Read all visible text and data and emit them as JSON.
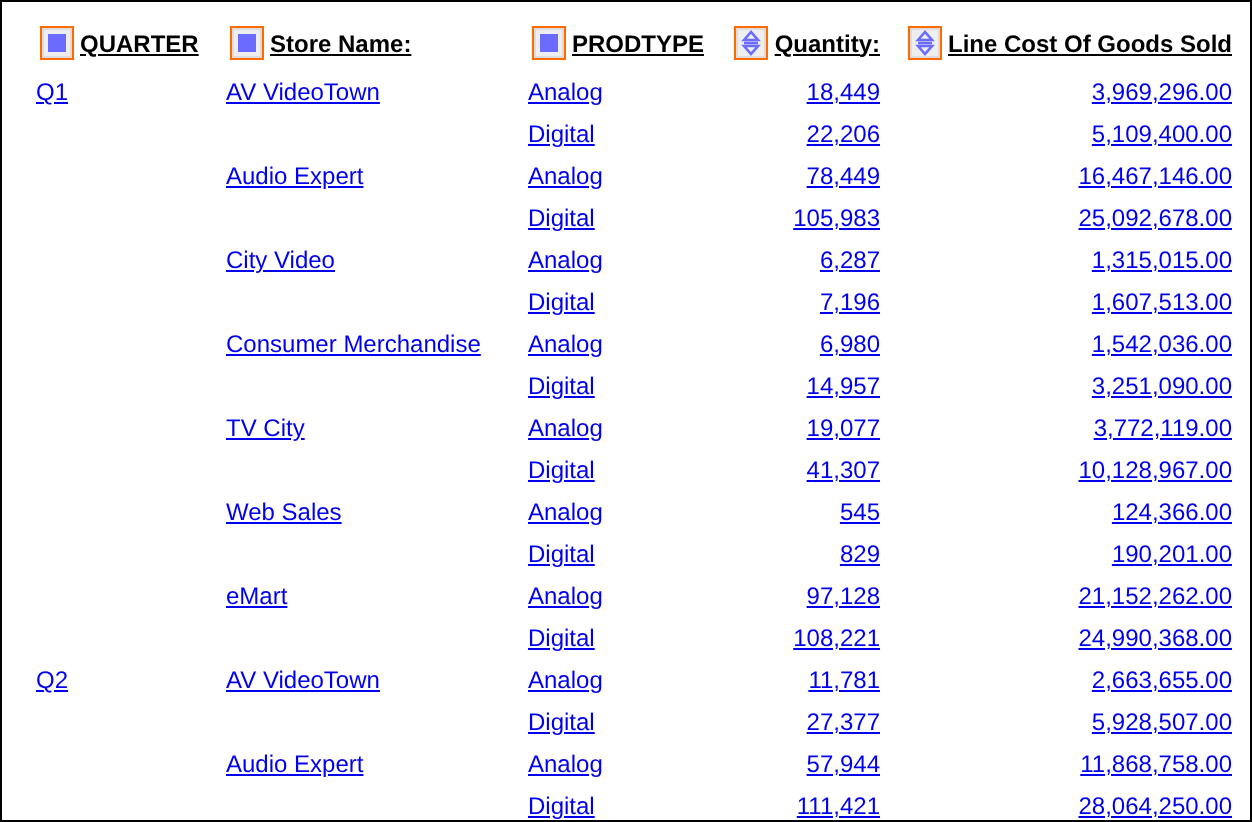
{
  "columns": [
    {
      "label": "QUARTER",
      "kind": "dimension"
    },
    {
      "label": "Store Name:",
      "kind": "dimension"
    },
    {
      "label": "PRODTYPE",
      "kind": "dimension"
    },
    {
      "label": "Quantity:",
      "kind": "measure"
    },
    {
      "label": "Line Cost Of Goods Sold",
      "kind": "measure"
    }
  ],
  "rows": [
    {
      "quarter": "Q1",
      "store": "AV VideoTown",
      "prodtype": "Analog",
      "quantity": "18,449",
      "cost": "3,969,296.00"
    },
    {
      "prodtype": "Digital",
      "quantity": "22,206",
      "cost": "5,109,400.00"
    },
    {
      "store": "Audio Expert",
      "prodtype": "Analog",
      "quantity": "78,449",
      "cost": "16,467,146.00"
    },
    {
      "prodtype": "Digital",
      "quantity": "105,983",
      "cost": "25,092,678.00"
    },
    {
      "store": "City Video",
      "prodtype": "Analog",
      "quantity": "6,287",
      "cost": "1,315,015.00"
    },
    {
      "prodtype": "Digital",
      "quantity": "7,196",
      "cost": "1,607,513.00"
    },
    {
      "store": "Consumer Merchandise",
      "prodtype": "Analog",
      "quantity": "6,980",
      "cost": "1,542,036.00"
    },
    {
      "prodtype": "Digital",
      "quantity": "14,957",
      "cost": "3,251,090.00"
    },
    {
      "store": "TV City",
      "prodtype": "Analog",
      "quantity": "19,077",
      "cost": "3,772,119.00"
    },
    {
      "prodtype": "Digital",
      "quantity": "41,307",
      "cost": "10,128,967.00"
    },
    {
      "store": "Web Sales",
      "prodtype": "Analog",
      "quantity": "545",
      "cost": "124,366.00"
    },
    {
      "prodtype": "Digital",
      "quantity": "829",
      "cost": "190,201.00"
    },
    {
      "store": "eMart",
      "prodtype": "Analog",
      "quantity": "97,128",
      "cost": "21,152,262.00"
    },
    {
      "prodtype": "Digital",
      "quantity": "108,221",
      "cost": "24,990,368.00"
    },
    {
      "quarter": "Q2",
      "store": "AV VideoTown",
      "prodtype": "Analog",
      "quantity": "11,781",
      "cost": "2,663,655.00"
    },
    {
      "prodtype": "Digital",
      "quantity": "27,377",
      "cost": "5,928,507.00"
    },
    {
      "store": "Audio Expert",
      "prodtype": "Analog",
      "quantity": "57,944",
      "cost": "11,868,758.00"
    },
    {
      "prodtype": "Digital",
      "quantity": "111,421",
      "cost": "28,064,250.00"
    }
  ]
}
